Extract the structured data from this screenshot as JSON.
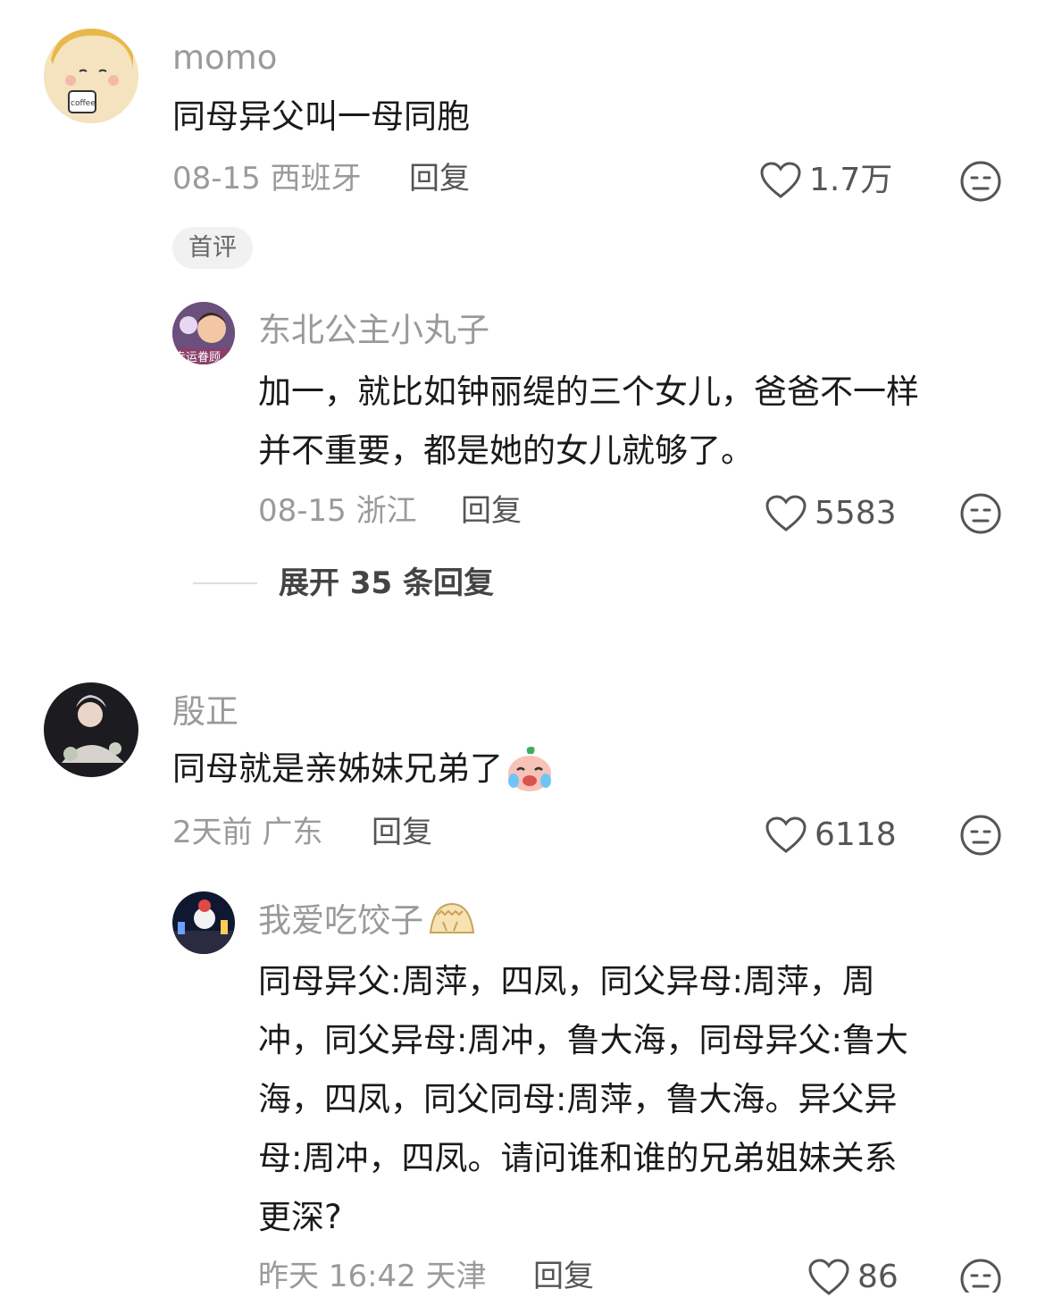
{
  "comments": [
    {
      "author": "momo",
      "text": "同母异父叫一母同胞",
      "date": "08-15",
      "location": "西班牙",
      "reply_label": "回复",
      "likes": "1.7万",
      "badge": "首评",
      "replies": [
        {
          "author": "东北公主小丸子",
          "avatar_text": "幸运眷顾",
          "text_lines": [
            "加一，就比如钟丽缇的三个女儿，爸爸不一样",
            "并不重要，都是她的女儿就够了。"
          ],
          "date": "08-15",
          "location": "浙江",
          "reply_label": "回复",
          "likes": "5583"
        }
      ],
      "expand_label": "展开 35 条回复"
    },
    {
      "author": "殷正",
      "text": "同母就是亲姊妹兄弟了",
      "emoji": "crying-laughing-bun-icon",
      "date": "2天前",
      "location": "广东",
      "reply_label": "回复",
      "likes": "6118",
      "replies": [
        {
          "author": "我爱吃饺子",
          "author_emoji": "dumpling-icon",
          "text_lines": [
            "同母异父:周萍，四凤，同父异母:周萍，周",
            "冲，同父异母:周冲，鲁大海，同母异父:鲁大",
            "海，四凤，同父同母:周萍，鲁大海。异父异",
            "母:周冲，四凤。请问谁和谁的兄弟姐妹关系",
            "更深?"
          ],
          "date": "昨天 16:42",
          "location": "天津",
          "reply_label": "回复",
          "likes": "86"
        }
      ]
    }
  ],
  "colors": {
    "meta": "#9a9a9a",
    "text": "#1a1a1a",
    "badge_bg": "#f1f1f1",
    "icon": "#555555"
  }
}
